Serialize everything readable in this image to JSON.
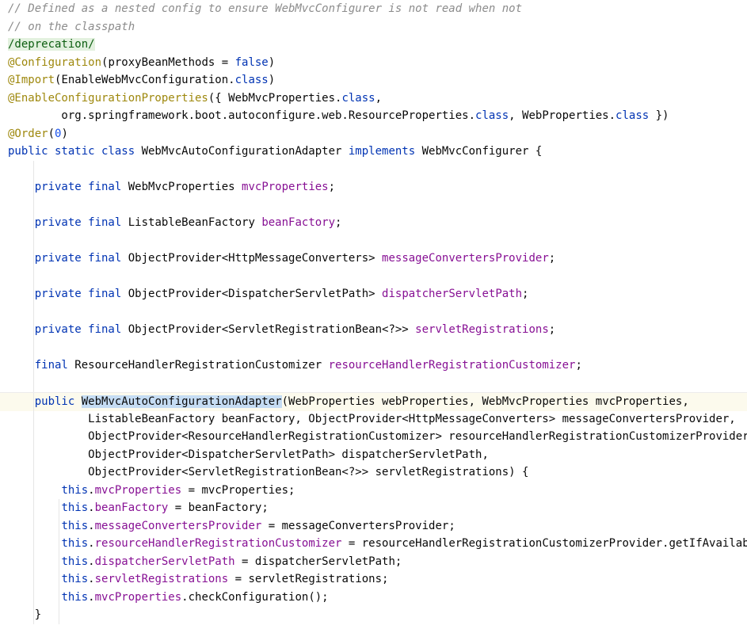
{
  "editor": {
    "lines": [
      [
        {
          "t": "// Defined as a nested config to ensure WebMvcConfigurer is not read when not",
          "c": "comment"
        }
      ],
      [
        {
          "t": "// on the classpath",
          "c": "comment"
        }
      ],
      [
        {
          "t": "/deprecation/",
          "c": "doc"
        }
      ],
      [
        {
          "t": "@Configuration",
          "c": "anno"
        },
        {
          "t": "(proxyBeanMethods = ",
          "c": ""
        },
        {
          "t": "false",
          "c": "kw"
        },
        {
          "t": ")",
          "c": ""
        }
      ],
      [
        {
          "t": "@Import",
          "c": "anno"
        },
        {
          "t": "(EnableWebMvcConfiguration.",
          "c": ""
        },
        {
          "t": "class",
          "c": "kw"
        },
        {
          "t": ")",
          "c": ""
        }
      ],
      [
        {
          "t": "@EnableConfigurationProperties",
          "c": "anno"
        },
        {
          "t": "({ WebMvcProperties.",
          "c": ""
        },
        {
          "t": "class",
          "c": "kw"
        },
        {
          "t": ",",
          "c": ""
        }
      ],
      [
        {
          "t": "        org.springframework.boot.autoconfigure.web.ResourceProperties.",
          "c": ""
        },
        {
          "t": "class",
          "c": "kw"
        },
        {
          "t": ", WebProperties.",
          "c": ""
        },
        {
          "t": "class",
          "c": "kw"
        },
        {
          "t": " })",
          "c": ""
        }
      ],
      [
        {
          "t": "@Order",
          "c": "anno"
        },
        {
          "t": "(",
          "c": ""
        },
        {
          "t": "0",
          "c": "num"
        },
        {
          "t": ")",
          "c": ""
        }
      ],
      [
        {
          "t": "public static class ",
          "c": "kw"
        },
        {
          "t": "WebMvcAutoConfigurationAdapter ",
          "c": ""
        },
        {
          "t": "implements ",
          "c": "kw"
        },
        {
          "t": "WebMvcConfigurer {",
          "c": ""
        }
      ],
      [],
      [
        {
          "t": "    ",
          "c": ""
        },
        {
          "t": "private final ",
          "c": "kw"
        },
        {
          "t": "WebMvcProperties ",
          "c": ""
        },
        {
          "t": "mvcProperties",
          "c": "field"
        },
        {
          "t": ";",
          "c": ""
        }
      ],
      [],
      [
        {
          "t": "    ",
          "c": ""
        },
        {
          "t": "private final ",
          "c": "kw"
        },
        {
          "t": "ListableBeanFactory ",
          "c": ""
        },
        {
          "t": "beanFactory",
          "c": "field"
        },
        {
          "t": ";",
          "c": ""
        }
      ],
      [],
      [
        {
          "t": "    ",
          "c": ""
        },
        {
          "t": "private final ",
          "c": "kw"
        },
        {
          "t": "ObjectProvider<HttpMessageConverters> ",
          "c": ""
        },
        {
          "t": "messageConvertersProvider",
          "c": "field"
        },
        {
          "t": ";",
          "c": ""
        }
      ],
      [],
      [
        {
          "t": "    ",
          "c": ""
        },
        {
          "t": "private final ",
          "c": "kw"
        },
        {
          "t": "ObjectProvider<DispatcherServletPath> ",
          "c": ""
        },
        {
          "t": "dispatcherServletPath",
          "c": "field"
        },
        {
          "t": ";",
          "c": ""
        }
      ],
      [],
      [
        {
          "t": "    ",
          "c": ""
        },
        {
          "t": "private final ",
          "c": "kw"
        },
        {
          "t": "ObjectProvider<ServletRegistrationBean<?>> ",
          "c": ""
        },
        {
          "t": "servletRegistrations",
          "c": "field"
        },
        {
          "t": ";",
          "c": ""
        }
      ],
      [],
      [
        {
          "t": "    ",
          "c": ""
        },
        {
          "t": "final ",
          "c": "kw"
        },
        {
          "t": "ResourceHandlerRegistrationCustomizer ",
          "c": ""
        },
        {
          "t": "resourceHandlerRegistrationCustomizer",
          "c": "field"
        },
        {
          "t": ";",
          "c": ""
        }
      ],
      [],
      [
        {
          "t": "    ",
          "c": ""
        },
        {
          "t": "public ",
          "c": "kw"
        },
        {
          "t": "WebMvcAutoConfigurationAdapter",
          "c": "usage"
        },
        {
          "t": "(WebProperties webProperties, WebMvcProperties mvcProperties,",
          "c": ""
        }
      ],
      [
        {
          "t": "            ListableBeanFactory beanFactory, ObjectProvider<HttpMessageConverters> messageConvertersProvider,",
          "c": ""
        }
      ],
      [
        {
          "t": "            ObjectProvider<ResourceHandlerRegistrationCustomizer> resourceHandlerRegistrationCustomizerProvider,",
          "c": ""
        }
      ],
      [
        {
          "t": "            ObjectProvider<DispatcherServletPath> dispatcherServletPath,",
          "c": ""
        }
      ],
      [
        {
          "t": "            ObjectProvider<ServletRegistrationBean<?>> servletRegistrations) {",
          "c": ""
        }
      ],
      [
        {
          "t": "        ",
          "c": ""
        },
        {
          "t": "this",
          "c": "kw"
        },
        {
          "t": ".",
          "c": ""
        },
        {
          "t": "mvcProperties",
          "c": "field"
        },
        {
          "t": " = mvcProperties;",
          "c": ""
        }
      ],
      [
        {
          "t": "        ",
          "c": ""
        },
        {
          "t": "this",
          "c": "kw"
        },
        {
          "t": ".",
          "c": ""
        },
        {
          "t": "beanFactory",
          "c": "field"
        },
        {
          "t": " = beanFactory;",
          "c": ""
        }
      ],
      [
        {
          "t": "        ",
          "c": ""
        },
        {
          "t": "this",
          "c": "kw"
        },
        {
          "t": ".",
          "c": ""
        },
        {
          "t": "messageConvertersProvider",
          "c": "field"
        },
        {
          "t": " = messageConvertersProvider;",
          "c": ""
        }
      ],
      [
        {
          "t": "        ",
          "c": ""
        },
        {
          "t": "this",
          "c": "kw"
        },
        {
          "t": ".",
          "c": ""
        },
        {
          "t": "resourceHandlerRegistrationCustomizer",
          "c": "field"
        },
        {
          "t": " = resourceHandlerRegistrationCustomizerProvider.getIfAvailable();",
          "c": ""
        }
      ],
      [
        {
          "t": "        ",
          "c": ""
        },
        {
          "t": "this",
          "c": "kw"
        },
        {
          "t": ".",
          "c": ""
        },
        {
          "t": "dispatcherServletPath",
          "c": "field"
        },
        {
          "t": " = dispatcherServletPath;",
          "c": ""
        }
      ],
      [
        {
          "t": "        ",
          "c": ""
        },
        {
          "t": "this",
          "c": "kw"
        },
        {
          "t": ".",
          "c": ""
        },
        {
          "t": "servletRegistrations",
          "c": "field"
        },
        {
          "t": " = servletRegistrations;",
          "c": ""
        }
      ],
      [
        {
          "t": "        ",
          "c": ""
        },
        {
          "t": "this",
          "c": "kw"
        },
        {
          "t": ".",
          "c": ""
        },
        {
          "t": "mvcProperties",
          "c": "field"
        },
        {
          "t": ".checkConfiguration();",
          "c": ""
        }
      ],
      [
        {
          "t": "    }",
          "c": ""
        }
      ]
    ],
    "current_line_index": 22,
    "colors": {
      "background": "#ffffff",
      "comment": "#8c8c8c",
      "keyword": "#0033b3",
      "annotation": "#9e880d",
      "field": "#871094",
      "number": "#1750eb",
      "doc_tag": "#0c5e10",
      "usage_highlight": "#c5dcf3",
      "current_line": "#fcfaed"
    }
  }
}
